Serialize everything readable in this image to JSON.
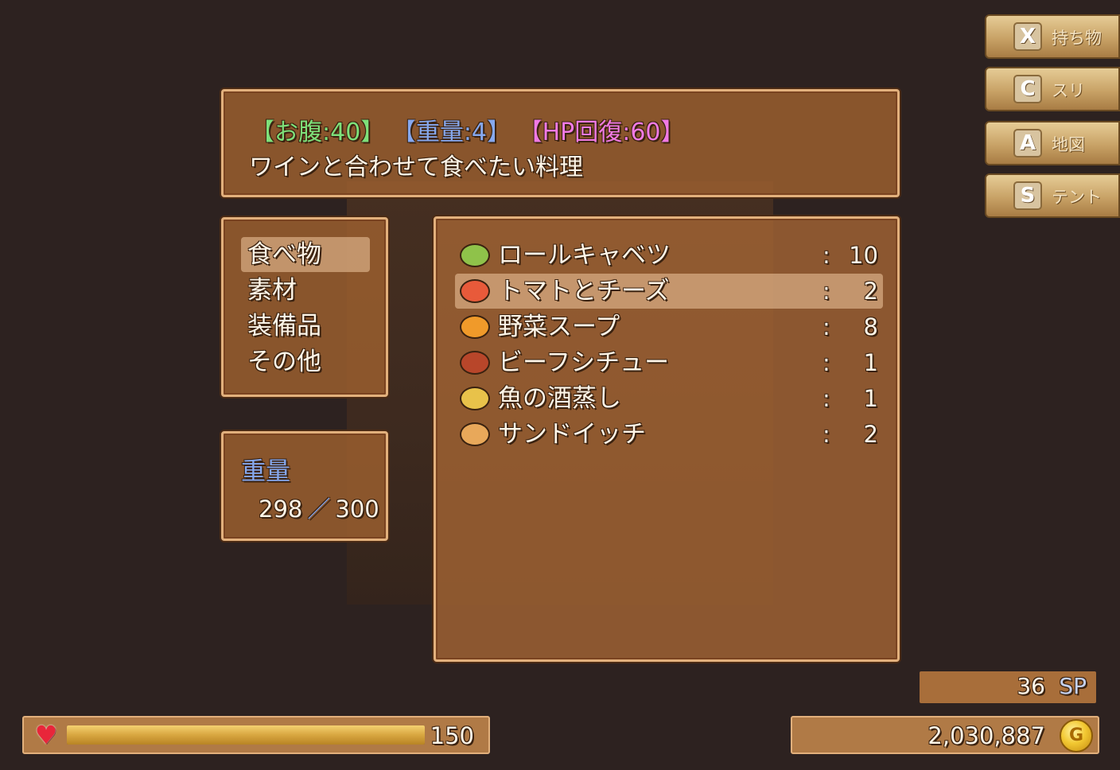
{
  "help": {
    "stat_hunger": "【お腹:40】",
    "stat_weight": "【重量:4】",
    "stat_hp": "【HP回復:60】",
    "description": "ワインと合わせて食べたい料理"
  },
  "categories": [
    {
      "label": "食べ物",
      "selected": true
    },
    {
      "label": "素材",
      "selected": false
    },
    {
      "label": "装備品",
      "selected": false
    },
    {
      "label": "その他",
      "selected": false
    }
  ],
  "weight": {
    "label": "重量",
    "current": "298",
    "separator": "／",
    "max": "300"
  },
  "items": [
    {
      "name": "ロールキャベツ",
      "colon": ":",
      "count": "10",
      "icon": "cabbage-roll-icon",
      "color": "#8fc24a",
      "selected": false
    },
    {
      "name": "トマトとチーズ",
      "colon": ":",
      "count": "2",
      "icon": "tomato-cheese-icon",
      "color": "#e85a3a",
      "selected": true
    },
    {
      "name": "野菜スープ",
      "colon": ":",
      "count": "8",
      "icon": "vegetable-soup-icon",
      "color": "#f09a2a",
      "selected": false
    },
    {
      "name": "ビーフシチュー",
      "colon": ":",
      "count": "1",
      "icon": "beef-stew-icon",
      "color": "#b8462a",
      "selected": false
    },
    {
      "name": "魚の酒蒸し",
      "colon": ":",
      "count": "1",
      "icon": "steamed-fish-icon",
      "color": "#e8c24a",
      "selected": false
    },
    {
      "name": "サンドイッチ",
      "colon": ":",
      "count": "2",
      "icon": "sandwich-icon",
      "color": "#e8a85a",
      "selected": false
    }
  ],
  "shortcuts": [
    {
      "key": "X",
      "label": "持ち物"
    },
    {
      "key": "C",
      "label": "スリ"
    },
    {
      "key": "A",
      "label": "地図"
    },
    {
      "key": "S",
      "label": "テント"
    }
  ],
  "hp": {
    "value": "150",
    "fill_percent": 100
  },
  "sp": {
    "value": "36",
    "unit": "SP"
  },
  "gold": {
    "value": "2,030,887",
    "coin": "G"
  }
}
